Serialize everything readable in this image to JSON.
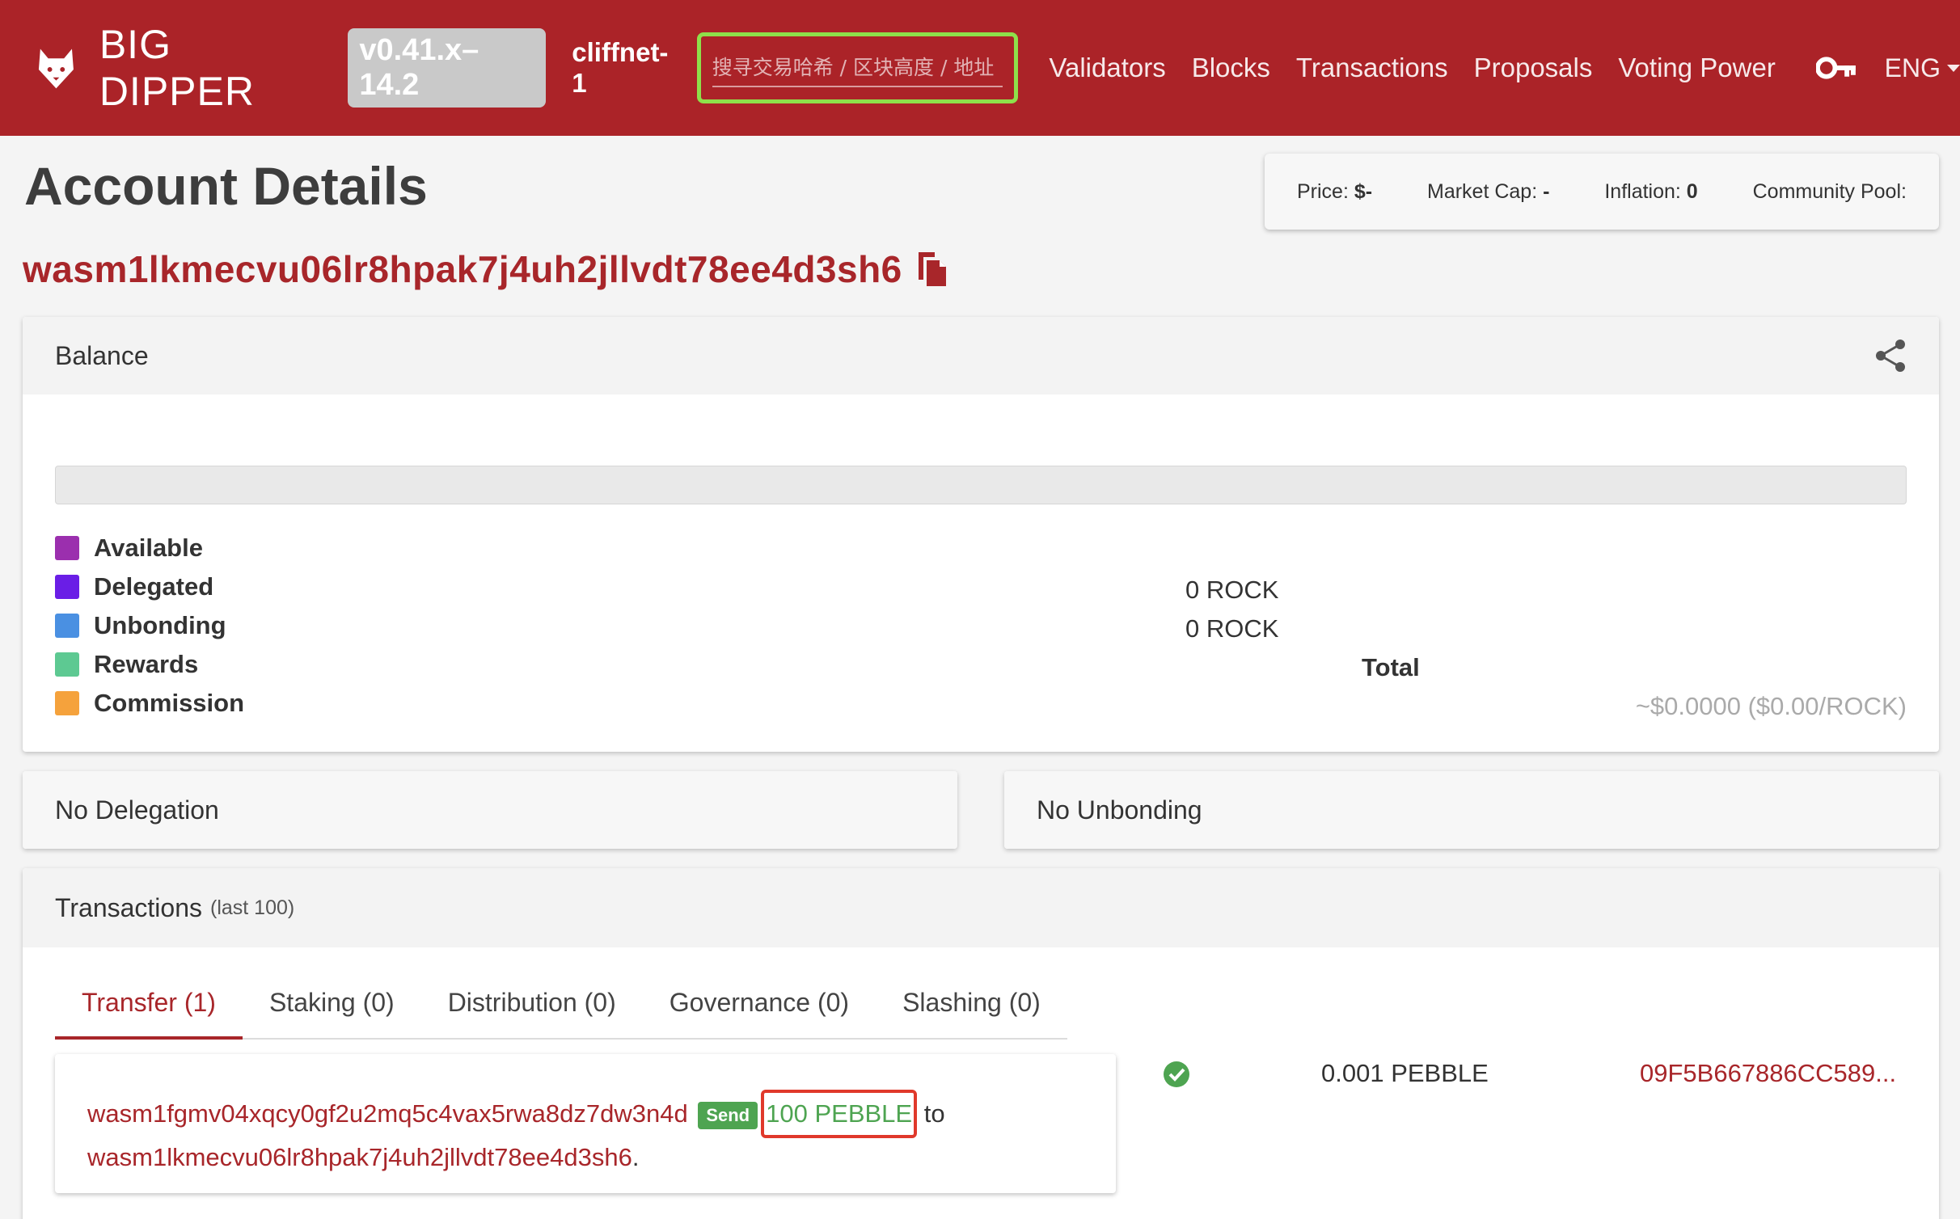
{
  "navbar": {
    "brand": "BIG DIPPER",
    "version": "v0.41.x–14.2",
    "chain": "cliffnet-1",
    "search_placeholder": "搜寻交易哈希 / 区块高度 / 地址",
    "links": [
      "Validators",
      "Blocks",
      "Transactions",
      "Proposals",
      "Voting Power"
    ],
    "language": "ENG"
  },
  "page": {
    "title": "Account Details",
    "address": "wasm1lkmecvu06lr8hpak7j4uh2jllvdt78ee4d3sh6"
  },
  "stats": {
    "price_label": "Price: ",
    "price_value": "$-",
    "market_cap_label": "Market Cap: ",
    "market_cap_value": "-",
    "inflation_label": "Inflation: ",
    "inflation_value": "0",
    "community_pool_label": "Community Pool:"
  },
  "balance": {
    "title": "Balance",
    "progress_available_percent": 0,
    "legend": [
      {
        "label": "Available",
        "color": "#9b2fae"
      },
      {
        "label": "Delegated",
        "color": "#6a1ee6"
      },
      {
        "label": "Unbonding",
        "color": "#4a90e2"
      },
      {
        "label": "Rewards",
        "color": "#5dc992"
      },
      {
        "label": "Commission",
        "color": "#f5a23c"
      }
    ],
    "delegated_amount": "0 ROCK",
    "unbonding_amount": "0 ROCK",
    "total_label": "Total",
    "total_usd": "~$0.0000 ($0.00/ROCK)"
  },
  "delegations": {
    "title": "No Delegation"
  },
  "unbondings": {
    "title": "No Unbonding"
  },
  "transactions": {
    "title": "Transactions",
    "subtitle": "(last 100)",
    "tabs": [
      "Transfer (1)",
      "Staking (0)",
      "Distribution (0)",
      "Governance (0)",
      "Slashing (0)"
    ],
    "items": [
      {
        "from": "wasm1fgmv04xqcy0gf2u2mq5c4vax5rwa8dz7dw3n4d",
        "type": "Send",
        "amount": "100 PEBBLE",
        "to_word": "to",
        "to": "wasm1lkmecvu06lr8hpak7j4uh2jllvdt78ee4d3sh6",
        "fee": "0.001 PEBBLE",
        "hash": "09F5B667886CC589..."
      }
    ]
  },
  "colors": {
    "brand": "#ab2328",
    "link": "#a8262a",
    "success": "#4ea451",
    "highlight_green": "#8ee04a",
    "highlight_red": "#e0392b"
  }
}
